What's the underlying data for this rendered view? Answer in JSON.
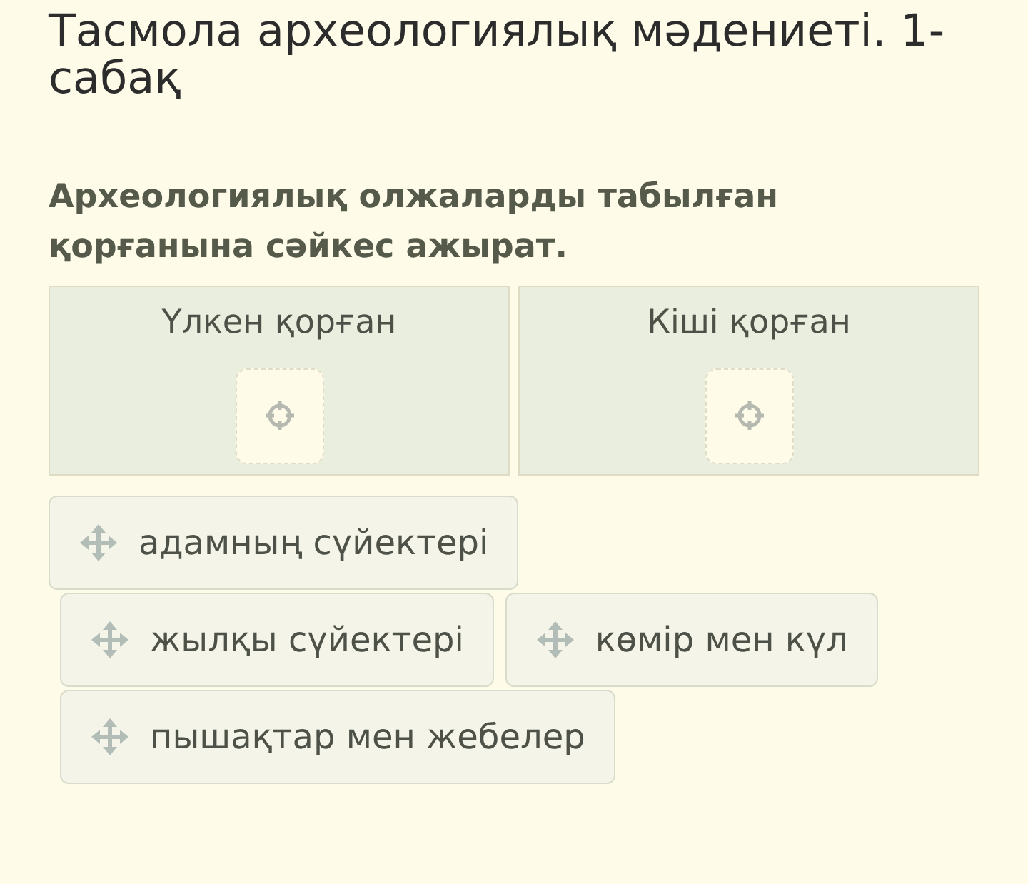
{
  "title": "Тасмола археологиялық мәдениеті. 1-сабақ",
  "question": "Археологиялық олжаларды табылған қорғанына сәйкес ажырат.",
  "drop_zones": [
    {
      "label": "Үлкен қорған"
    },
    {
      "label": "Кіші қорған"
    }
  ],
  "answer_rows": [
    [
      "адамның сүйектері"
    ],
    [
      "жылқы сүйектері",
      "көмір мен күл"
    ],
    [
      "пышақтар мен жебелер"
    ]
  ]
}
